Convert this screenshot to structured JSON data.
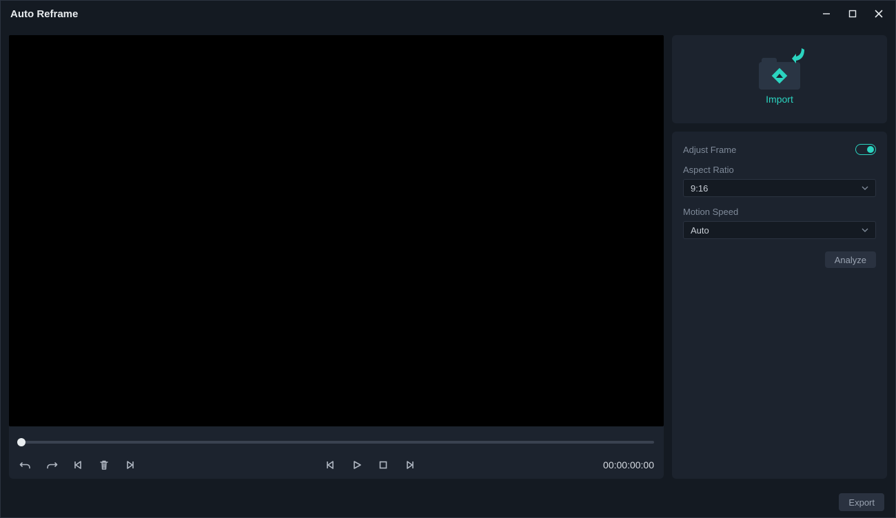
{
  "window": {
    "title": "Auto Reframe"
  },
  "import": {
    "label": "Import"
  },
  "settings": {
    "adjust_frame_label": "Adjust Frame",
    "adjust_frame_on": true,
    "aspect_ratio": {
      "label": "Aspect Ratio",
      "value": "9:16"
    },
    "motion_speed": {
      "label": "Motion Speed",
      "value": "Auto"
    },
    "analyze_label": "Analyze"
  },
  "player": {
    "timecode": "00:00:00:00"
  },
  "footer": {
    "export_label": "Export"
  }
}
